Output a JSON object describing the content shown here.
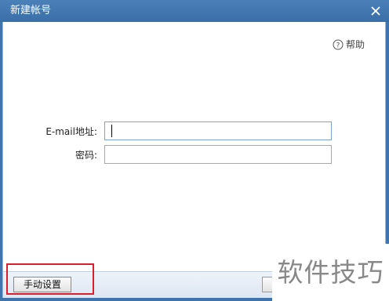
{
  "window": {
    "title": "新建帐号",
    "close_icon": "close-icon"
  },
  "help": {
    "label": "帮助",
    "icon": "question-circle-icon"
  },
  "form": {
    "email_label": "E-mail地址:",
    "email_value": "",
    "password_label": "密码:",
    "password_value": ""
  },
  "footer": {
    "manual_setup_label": "手动设置"
  },
  "annotation": {
    "highlight_color": "#d9202a"
  },
  "watermark": {
    "text": "软件技巧"
  }
}
